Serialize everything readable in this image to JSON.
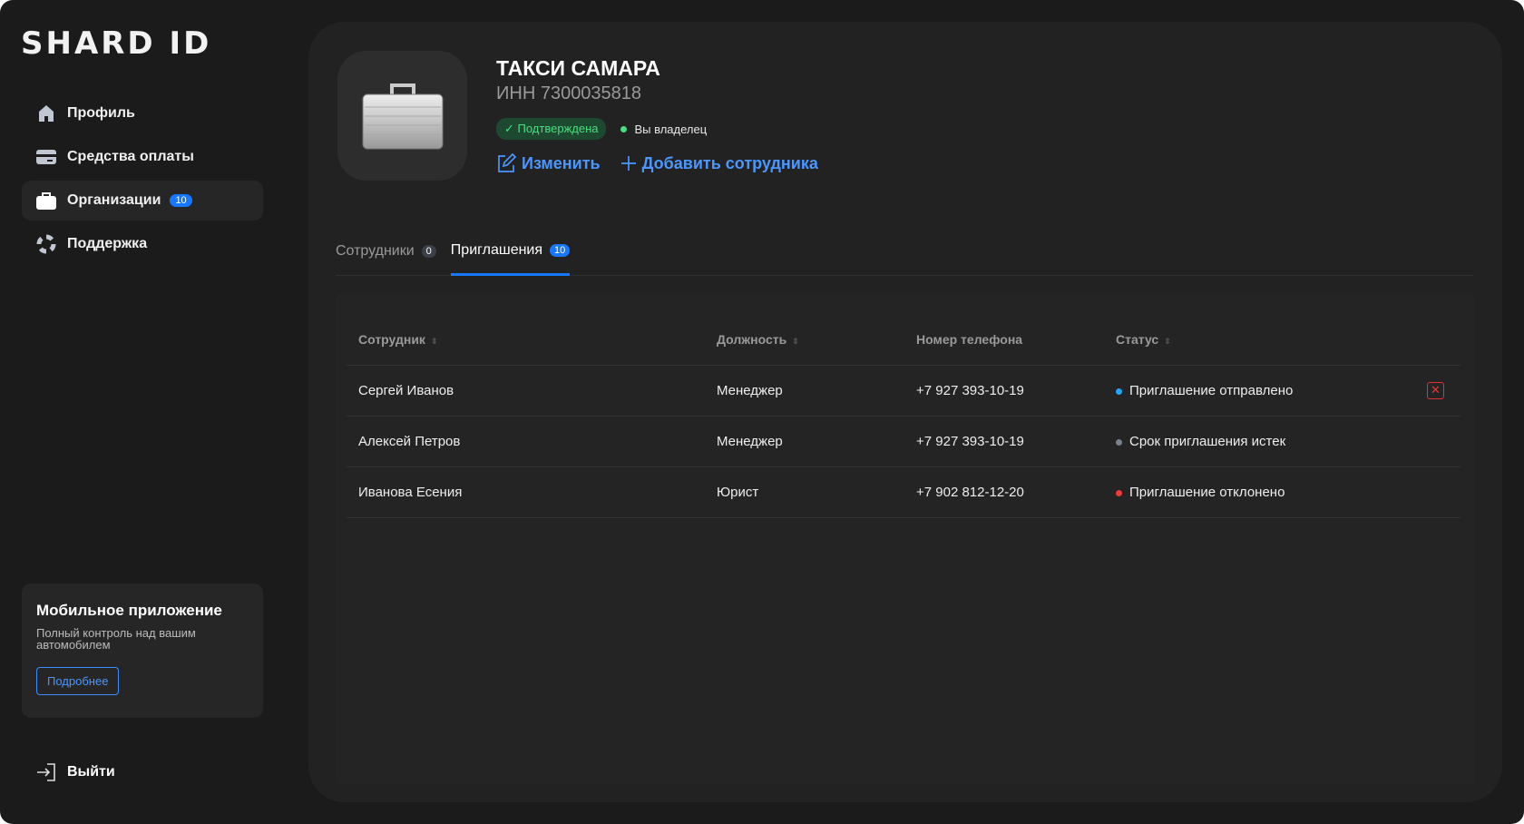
{
  "logo": "SHARD ID",
  "sidebar": {
    "items": [
      {
        "label": "Профиль",
        "icon": "home-icon"
      },
      {
        "label": "Средства оплаты",
        "icon": "card-icon"
      },
      {
        "label": "Организации",
        "icon": "briefcase-icon",
        "badge": "10"
      },
      {
        "label": "Поддержка",
        "icon": "lifebuoy-icon"
      }
    ]
  },
  "mobile": {
    "title": "Мобильное приложение",
    "text": "Полный контроль над вашим автомобилем",
    "button": "Подробнее"
  },
  "logout": "Выйти",
  "org": {
    "name": "ТАКСИ САМАРА",
    "inn": "ИНН 7300035818",
    "verified": "Подтверждена",
    "owner": "Вы владелец",
    "edit": "Изменить",
    "add": "Добавить сотрудника"
  },
  "tabs": [
    {
      "label": "Сотрудники",
      "count": "0"
    },
    {
      "label": "Приглашения",
      "count": "10"
    }
  ],
  "table": {
    "headers": [
      "Сотрудник",
      "Должность",
      "Номер телефона",
      "Статус"
    ],
    "rows": [
      {
        "name": "Сергей Иванов",
        "position": "Менеджер",
        "phone": "+7 927 393-10-19",
        "status": "Приглашение отправлено",
        "color": "#1ea7ff"
      },
      {
        "name": "Алексей Петров",
        "position": "Менеджер",
        "phone": "+7 927 393-10-19",
        "status": "Срок приглашения истек",
        "color": "#7a8090"
      },
      {
        "name": "Иванова Есения",
        "position": "Юрист",
        "phone": "+7 902 812-12-20",
        "status": "Приглашение отклонено",
        "color": "#ef3b3b"
      }
    ]
  },
  "colors": {
    "accent": "#1677ff",
    "link": "#4b96ff",
    "verified": "#4ade80"
  }
}
